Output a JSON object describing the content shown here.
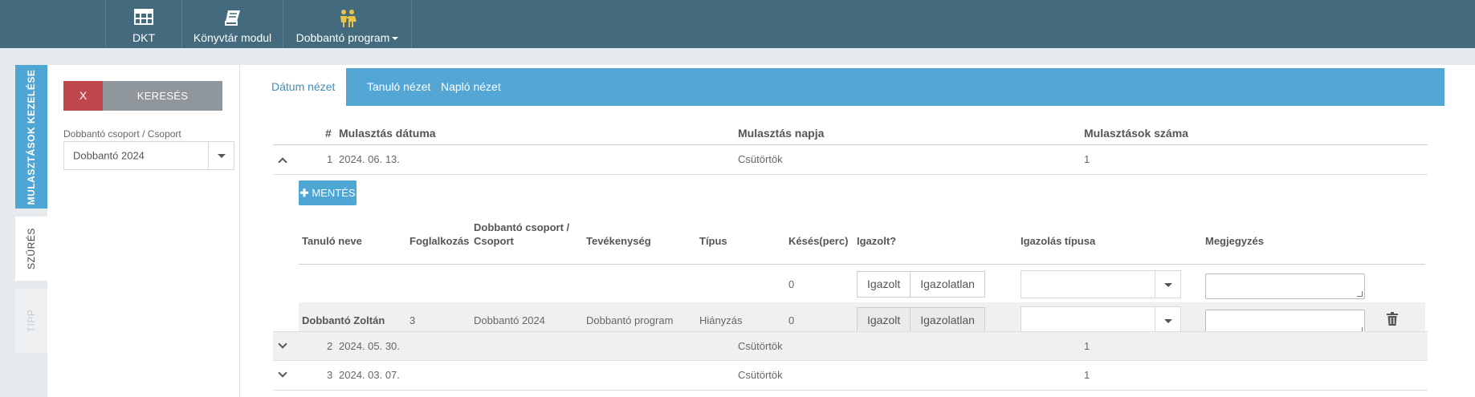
{
  "topnav": {
    "items": [
      {
        "label": "DKT",
        "icon": "table-icon"
      },
      {
        "label": "Könyvtár modul",
        "icon": "book-icon"
      },
      {
        "label": "Dobbantó program",
        "icon": "children-icon",
        "has_dropdown": true
      }
    ],
    "icon_accent": "#e8c34a"
  },
  "side_tabs": [
    {
      "label": "MULASZTÁSOK KEZELÉSE",
      "state": "active"
    },
    {
      "label": "SZŰRÉS",
      "state": "selected"
    },
    {
      "label": "TIPP",
      "state": "disabled"
    }
  ],
  "filter": {
    "clear_label": "X",
    "search_label": "KERESÉS",
    "group_label": "Dobbantó csoport / Csoport",
    "group_value": "Dobbantó 2024"
  },
  "tabs": [
    {
      "label": "Dátum nézet",
      "active": true
    },
    {
      "label": "Tanuló nézet",
      "active": false
    },
    {
      "label": "Napló nézet",
      "active": false
    }
  ],
  "grid": {
    "columns": [
      "#",
      "Mulasztás dátuma",
      "Mulasztás napja",
      "Mulasztások száma"
    ],
    "rows": [
      {
        "num": "1",
        "date": "2024. 06. 13.",
        "day": "Csütörtök",
        "count": "1",
        "expanded": true
      },
      {
        "num": "2",
        "date": "2024. 05. 30.",
        "day": "Csütörtök",
        "count": "1",
        "expanded": false
      },
      {
        "num": "3",
        "date": "2024. 03. 07.",
        "day": "Csütörtök",
        "count": "1",
        "expanded": false
      }
    ]
  },
  "detail": {
    "save_label": "MENTÉS",
    "columns": {
      "student": "Tanuló neve",
      "lesson": "Foglalkozás",
      "group_line1": "Dobbantó csoport /",
      "group_line2": "Csoport",
      "activity": "Tevékenység",
      "type": "Típus",
      "late": "Késés(perc)",
      "justified": "Igazolt?",
      "justify_type": "Igazolás típusa",
      "note": "Megjegyzés"
    },
    "bulk_row": {
      "late": "0",
      "justified_label": "Igazolt",
      "unjustified_label": "Igazolatlan",
      "justify_type": "",
      "note": ""
    },
    "student_row": {
      "student": "Dobbantó Zoltán",
      "lesson": "3",
      "group": "Dobbantó 2024",
      "activity": "Dobbantó program",
      "type": "Hiányzás",
      "late": "0",
      "justified_label": "Igazolt",
      "unjustified_label": "Igazolatlan",
      "justify_type": "",
      "note": ""
    }
  },
  "colors": {
    "nav_bg": "#436a7d",
    "accent": "#4ea6d4",
    "danger": "#c0464e",
    "muted_button": "#8f979d"
  }
}
